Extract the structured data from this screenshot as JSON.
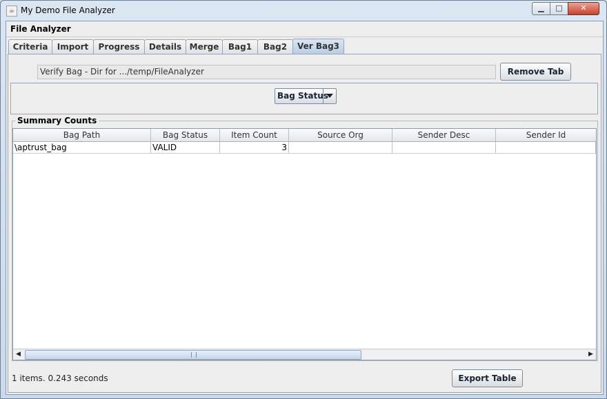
{
  "window": {
    "title": "My Demo File Analyzer",
    "close_glyph": "✕",
    "min_glyph": "▁",
    "max_glyph": "□"
  },
  "app": {
    "label": "File Analyzer"
  },
  "tabs": [
    {
      "label": "Criteria"
    },
    {
      "label": "Import"
    },
    {
      "label": "Progress"
    },
    {
      "label": "Details"
    },
    {
      "label": "Merge"
    },
    {
      "label": "Bag1"
    },
    {
      "label": "Bag2"
    },
    {
      "label": "Ver Bag3",
      "active": true
    }
  ],
  "panel": {
    "info_text": "Verify Bag - Dir for .../temp/FileAnalyzer",
    "remove_label": "Remove Tab",
    "combo_value": "Bag Status"
  },
  "summary": {
    "legend": "Summary Counts",
    "columns": [
      "Bag Path",
      "Bag Status",
      "Item Count",
      "Source Org",
      "Sender Desc",
      "Sender Id"
    ],
    "rows": [
      {
        "bag_path": "\\aptrust_bag",
        "bag_status": "VALID",
        "item_count": "3",
        "source_org": "",
        "sender_desc": "",
        "sender_id": ""
      }
    ]
  },
  "footer": {
    "status": "1 items.  0.243 seconds",
    "export_label": "Export Table"
  },
  "colors": {
    "accent": "#b8cde3",
    "close": "#c7432d"
  }
}
